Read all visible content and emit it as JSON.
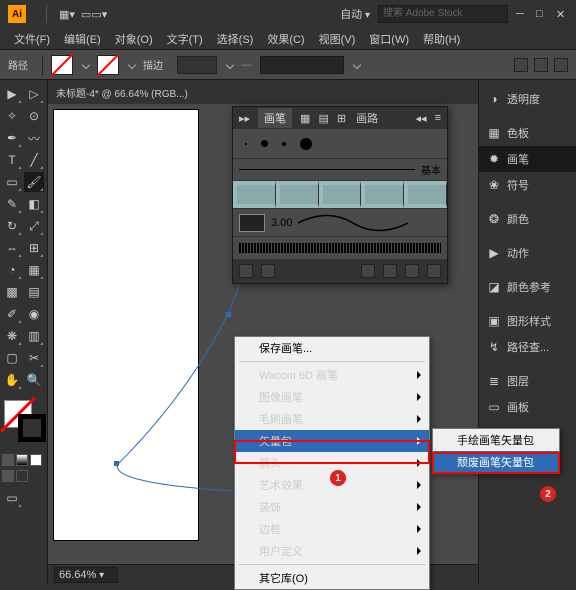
{
  "title_dropdown": "自动",
  "search_placeholder": "搜索 Adobe Stock",
  "menubar": [
    "文件(F)",
    "编辑(E)",
    "对象(O)",
    "文字(T)",
    "选择(S)",
    "效果(C)",
    "视图(V)",
    "窗口(W)",
    "帮助(H)"
  ],
  "optbar": {
    "label": "路径",
    "stroke_label": "描边"
  },
  "doc_tab": "未标题-4* @ 66.64% (RGB...)",
  "zoom": "66.64%",
  "right_panels": [
    {
      "icon": "◑",
      "label": "透明度"
    },
    {
      "icon": "▦",
      "label": "色板"
    },
    {
      "icon": "✹",
      "label": "画笔",
      "sel": true
    },
    {
      "icon": "❀",
      "label": "符号"
    },
    {
      "icon": "❂",
      "label": "颜色"
    },
    {
      "icon": "▶",
      "label": "动作"
    },
    {
      "icon": "◪",
      "label": "颜色参考"
    },
    {
      "icon": "▣",
      "label": "图形样式"
    },
    {
      "icon": "↯",
      "label": "路径查..."
    },
    {
      "icon": "≣",
      "label": "图层"
    },
    {
      "icon": "▭",
      "label": "画板"
    }
  ],
  "brush_panel": {
    "tab": "画笔",
    "tab2": "画路",
    "basic_label": "基本",
    "width_val": "3.00"
  },
  "ctx_menu": [
    {
      "label": "保存画笔...",
      "arrow": false
    },
    {
      "sep": true
    },
    {
      "label": "Wacom 6D 画笔",
      "arrow": true
    },
    {
      "label": "图像画笔",
      "arrow": true
    },
    {
      "label": "毛刷画笔",
      "arrow": true
    },
    {
      "label": "矢量包",
      "arrow": true,
      "hi": true
    },
    {
      "label": "箭头",
      "arrow": true
    },
    {
      "label": "艺术效果",
      "arrow": true
    },
    {
      "label": "装饰",
      "arrow": true
    },
    {
      "label": "边框",
      "arrow": true
    },
    {
      "label": "用户定义",
      "arrow": true
    },
    {
      "sep": true
    },
    {
      "label": "其它库(O)",
      "arrow": false
    }
  ],
  "sub_menu": [
    "手绘画笔矢量包",
    "颓废画笔矢量包"
  ],
  "callouts": {
    "c1": "1",
    "c2": "2"
  }
}
